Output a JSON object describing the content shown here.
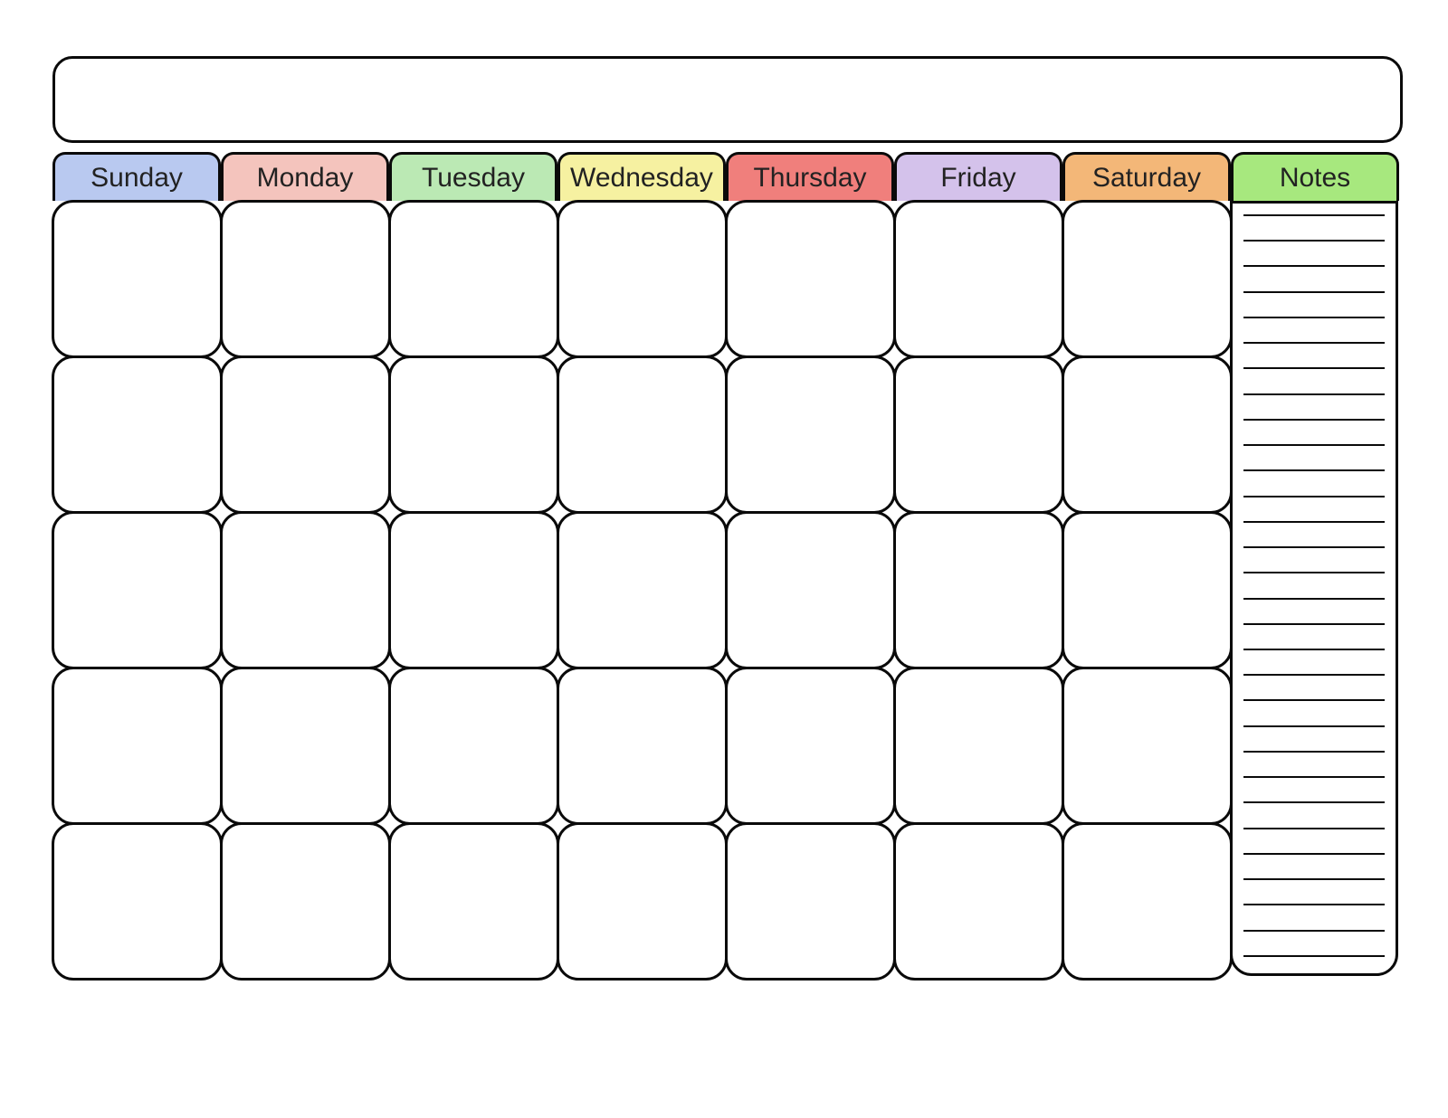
{
  "headers": {
    "days": [
      {
        "label": "Sunday",
        "color": "#b9c9f0"
      },
      {
        "label": "Monday",
        "color": "#f4c4bd"
      },
      {
        "label": "Tuesday",
        "color": "#bbe9b4"
      },
      {
        "label": "Wednesday",
        "color": "#f6f1a1"
      },
      {
        "label": "Thursday",
        "color": "#f07f7c"
      },
      {
        "label": "Friday",
        "color": "#d4c2eb"
      },
      {
        "label": "Saturday",
        "color": "#f3b778"
      }
    ],
    "notes": {
      "label": "Notes",
      "color": "#a7e87e"
    }
  },
  "title": "",
  "grid": {
    "rows": 5,
    "cols": 7,
    "cells": [
      [
        "",
        "",
        "",
        "",
        "",
        "",
        ""
      ],
      [
        "",
        "",
        "",
        "",
        "",
        "",
        ""
      ],
      [
        "",
        "",
        "",
        "",
        "",
        "",
        ""
      ],
      [
        "",
        "",
        "",
        "",
        "",
        "",
        ""
      ],
      [
        "",
        "",
        "",
        "",
        "",
        "",
        ""
      ]
    ]
  },
  "notes_lines": 30
}
